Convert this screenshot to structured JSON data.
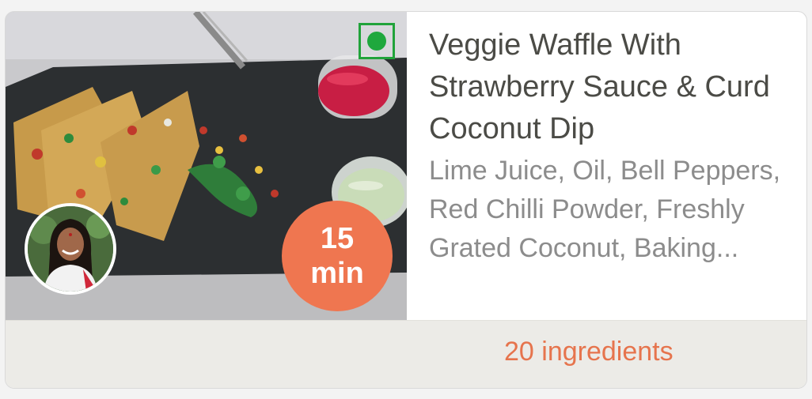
{
  "recipe": {
    "title": "Veggie Waffle With Strawberry Sauce & Curd Coconut Dip",
    "ingredients_preview": "Lime Juice, Oil, Bell Peppers, Red Chilli Powder, Freshly Grated Coconut, Baking...",
    "ingredient_count": "20 ingredients",
    "time_value": "15",
    "time_unit": "min",
    "diet_icon": "veg-indicator-icon",
    "chef_avatar_icon": "chef-avatar",
    "colors": {
      "accent": "#ef7650",
      "veg_green": "#1fa83d",
      "title_text": "#4b4b46",
      "muted_text": "#8c8c8c",
      "footer_bg": "#ecebe7"
    }
  }
}
